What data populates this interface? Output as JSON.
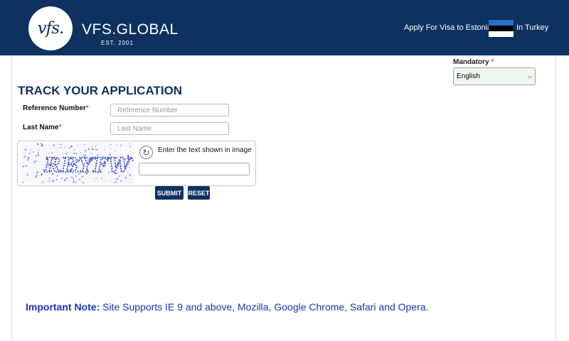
{
  "header": {
    "logo_text": "vfs.",
    "brand": "VFS.GLOBAL",
    "established": "EST. 2001",
    "apply_text": "Apply For Visa to Estonia",
    "country_text": "In Turkey",
    "flag_colors": [
      "#2a6ec6",
      "#000000",
      "#ffffff"
    ]
  },
  "language": {
    "mandatory_label": "Mandatory",
    "required_star": "*",
    "selected": "English",
    "select_bg": "#eef8ee"
  },
  "form": {
    "title": "TRACK YOUR APPLICATION",
    "reference_label": "Reference Number",
    "reference_placeholder": "Reference Number",
    "lastname_label": "Last Name",
    "lastname_placeholder": "Last Name",
    "required_star": "*",
    "captcha_text": "RBYFW",
    "captcha_hint": "Enter the text shown in image",
    "submit_label": "SUBMIT",
    "reset_label": "RESET"
  },
  "note": {
    "prefix": "Important Note:",
    "text": " Site Supports IE 9 and above, Mozilla, Google Chrome, Safari and Opera."
  },
  "colors": {
    "brand_navy": "#0e3160",
    "title_navy": "#10305e",
    "required_red": "#e00000",
    "note_blue": "#1a36b4"
  },
  "icons": {
    "refresh": "refresh-icon",
    "dropdown": "chevron-down-icon"
  }
}
